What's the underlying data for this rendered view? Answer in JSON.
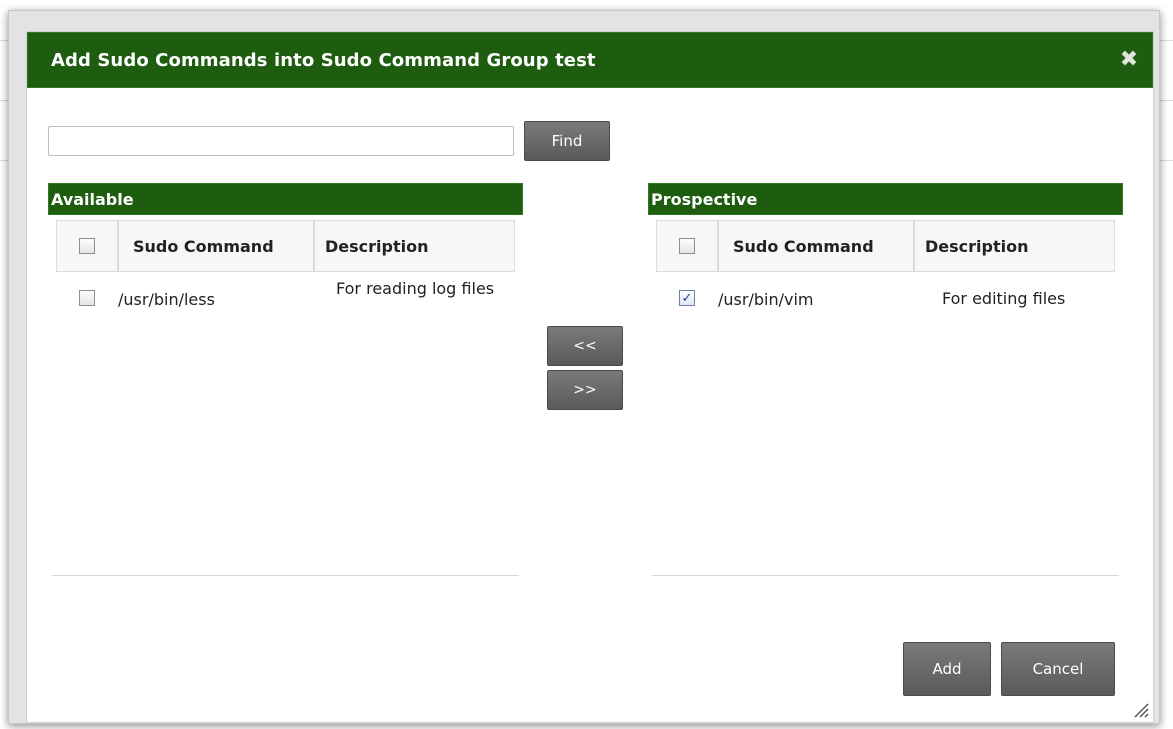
{
  "dialog": {
    "title": "Add Sudo Commands into Sudo Command Group test",
    "close_icon": "close-icon",
    "close_glyph": "✖"
  },
  "search": {
    "value": "",
    "placeholder": "",
    "find_label": "Find"
  },
  "available": {
    "title": "Available",
    "columns": [
      "Sudo Command",
      "Description"
    ],
    "rows": [
      {
        "checked": false,
        "command": "/usr/bin/less",
        "description": "For reading log files"
      }
    ]
  },
  "prospective": {
    "title": "Prospective",
    "columns": [
      "Sudo Command",
      "Description"
    ],
    "rows": [
      {
        "checked": true,
        "command": "/usr/bin/vim",
        "description": "For editing files"
      }
    ]
  },
  "move": {
    "left_label": "<<",
    "right_label": ">>"
  },
  "footer": {
    "add_label": "Add",
    "cancel_label": "Cancel"
  },
  "colors": {
    "header_green": "#1e5d10",
    "button_gray": "#6a6a6a"
  }
}
